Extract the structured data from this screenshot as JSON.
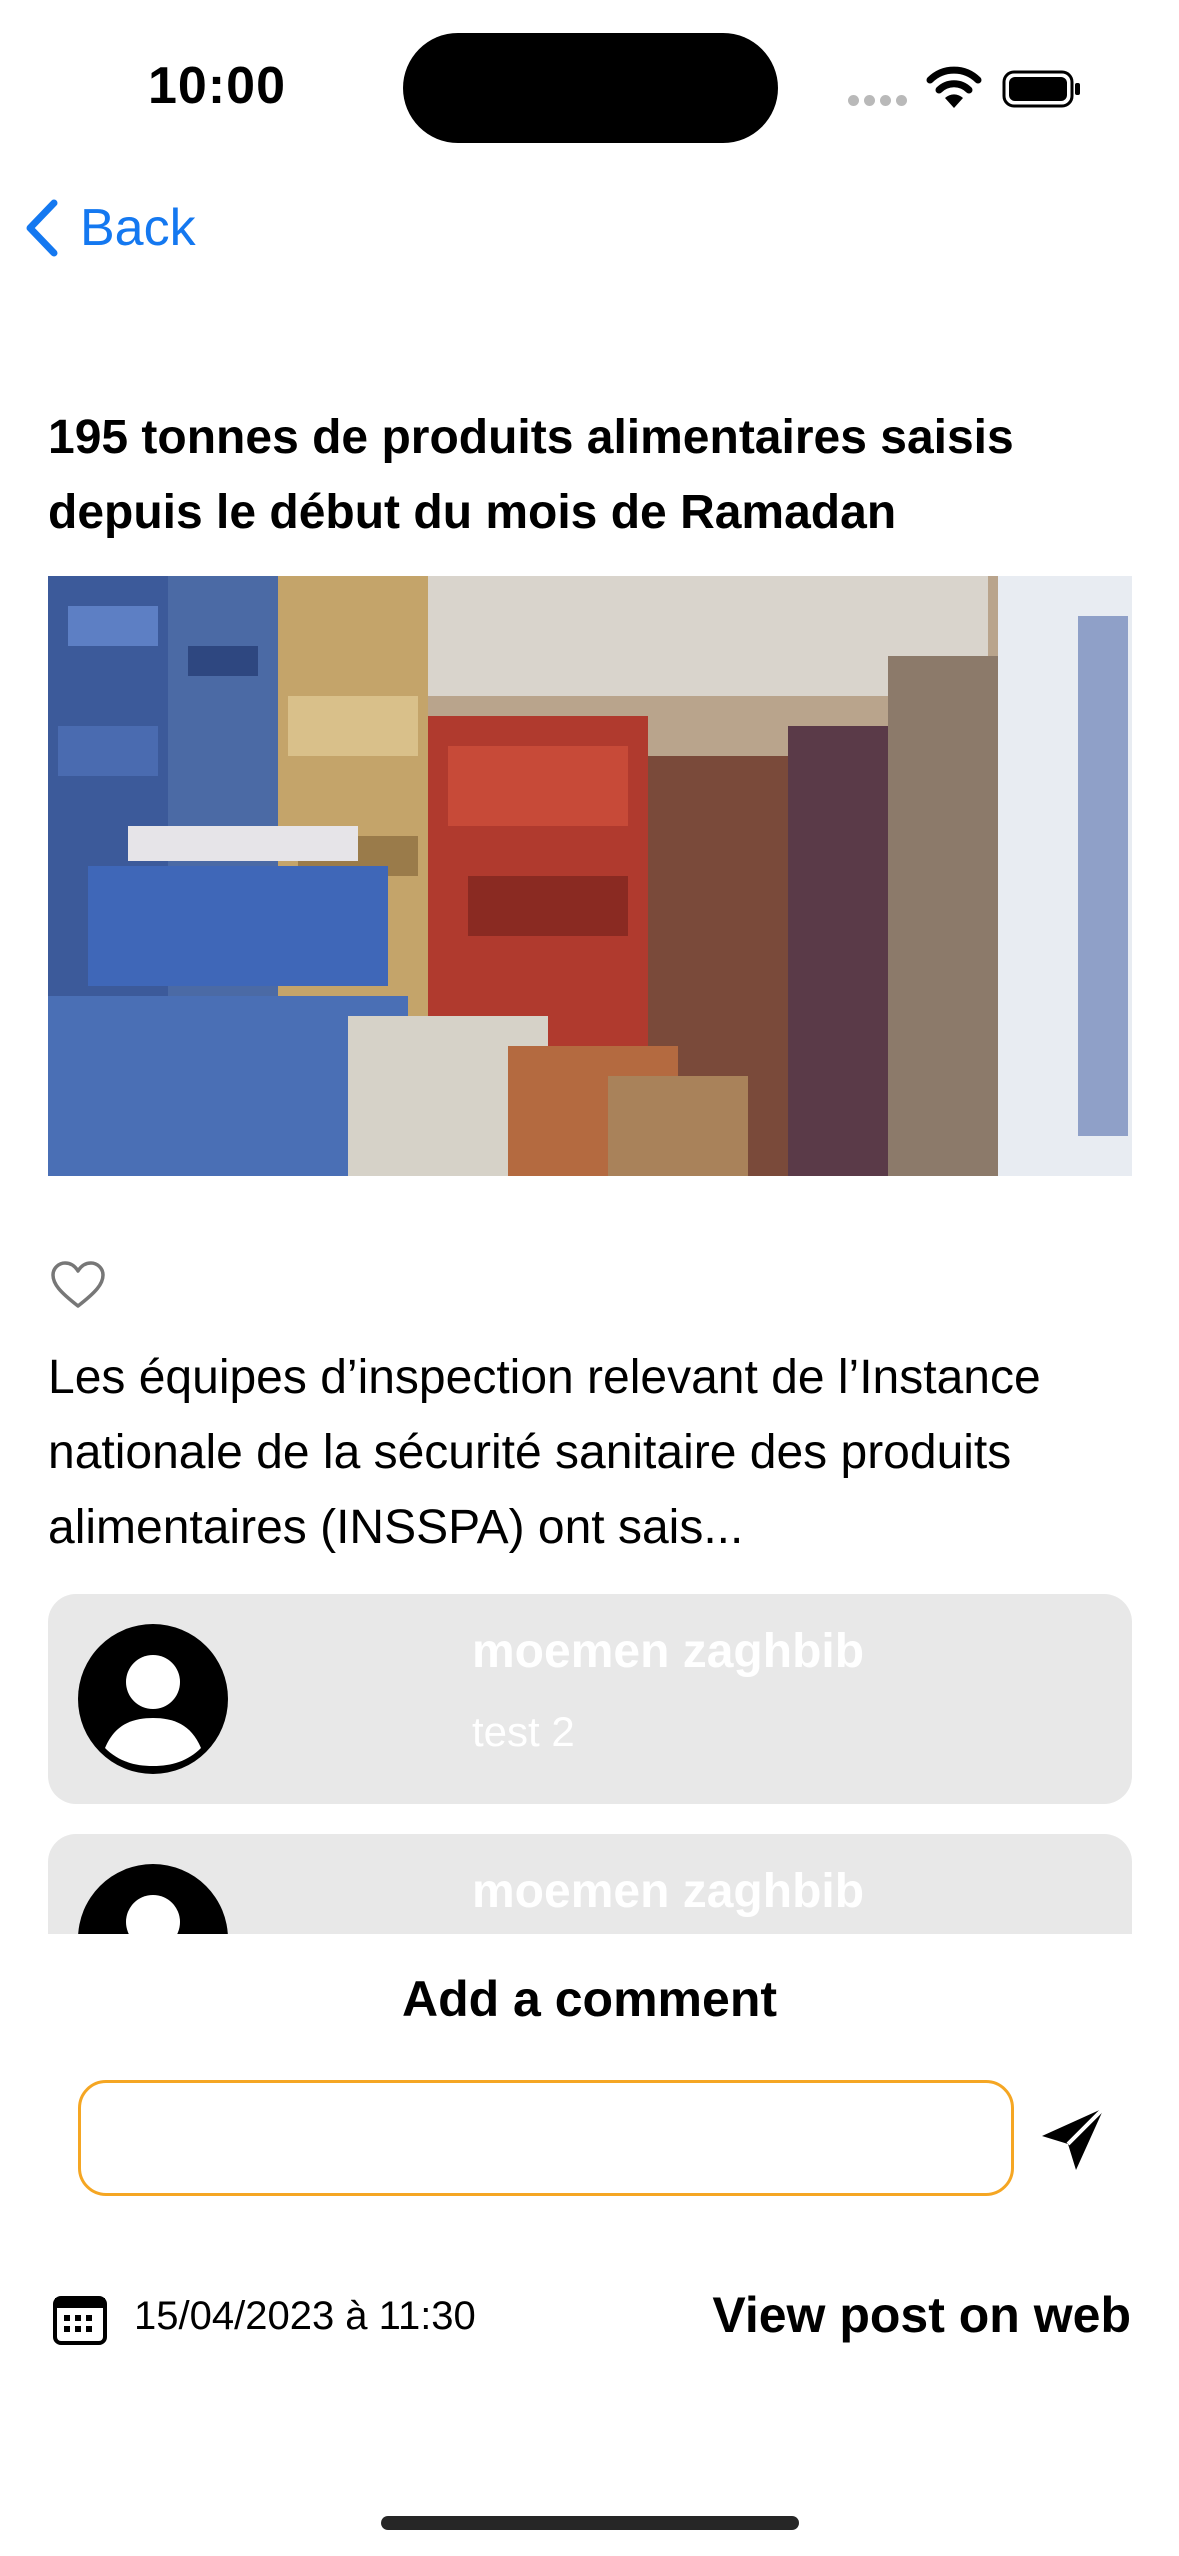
{
  "status_bar": {
    "time": "10:00"
  },
  "nav": {
    "back_label": "Back"
  },
  "post": {
    "title": "195 tonnes de produits alimentaires saisis depuis le début du mois de Ramadan",
    "excerpt": "Les équipes d’inspection relevant de l’Instance nationale de la sécurité sanitaire des produits alimentaires (INSSPA) ont sais...",
    "date": "15/04/2023 à 11:30",
    "view_on_web_label": "View post on web",
    "liked": false
  },
  "comments": [
    {
      "author": "moemen zaghbib",
      "text": "test 2"
    },
    {
      "author": "moemen zaghbib",
      "text": ""
    }
  ],
  "comment_form": {
    "heading": "Add a comment",
    "input_value": "",
    "input_placeholder": ""
  },
  "colors": {
    "accent_blue": "#1478f0",
    "input_border": "#f5a623",
    "card_bg": "#e8e8e8"
  }
}
